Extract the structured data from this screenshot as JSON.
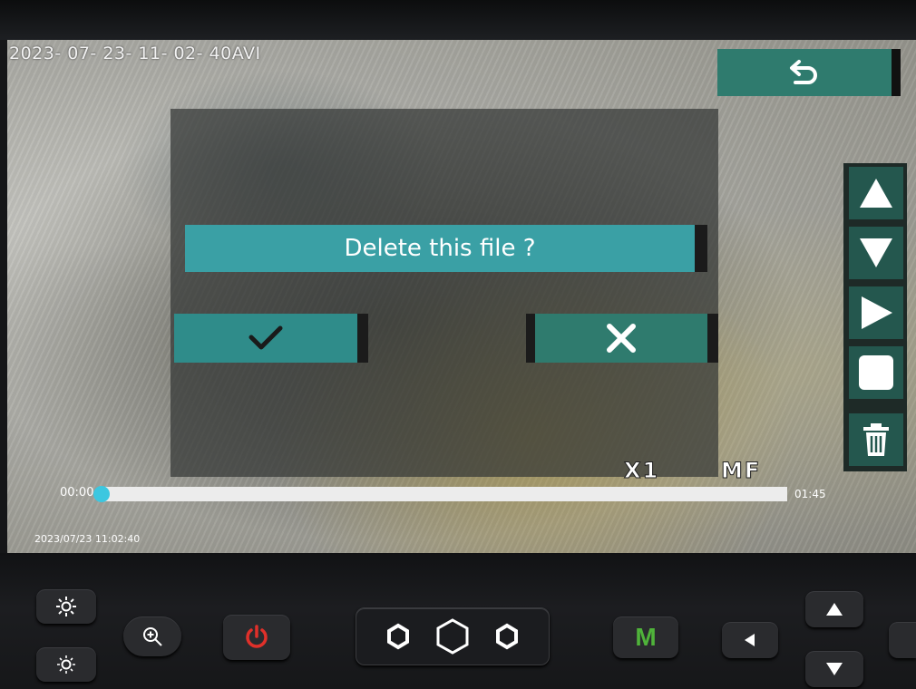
{
  "screen": {
    "filename": "2023- 07- 23- 11- 02- 40AVI",
    "dialog": {
      "message": "Delete this file ?",
      "confirm_icon": "check-icon",
      "cancel_icon": "x-icon"
    },
    "back_icon": "back-arrow-icon",
    "side_buttons": [
      {
        "name": "up-button",
        "icon": "triangle-up-icon"
      },
      {
        "name": "down-button",
        "icon": "triangle-down-icon"
      },
      {
        "name": "play-button",
        "icon": "play-icon"
      },
      {
        "name": "stop-button",
        "icon": "stop-icon"
      },
      {
        "name": "delete-button",
        "icon": "trash-icon"
      }
    ],
    "zoom_label": "X1",
    "focus_label": "MF",
    "playback": {
      "current_time": "00:00",
      "total_time": "01:45",
      "progress": 0
    },
    "datestamp": "2023/07/23 11:02:40"
  },
  "hardware_buttons": {
    "mode_label": "M",
    "icons": [
      "brightness-up-icon",
      "brightness-down-icon",
      "zoom-in-icon",
      "power-icon",
      "hexagon-icons",
      "mode-button",
      "left-arrow-icon",
      "up-arrow-icon",
      "down-arrow-icon"
    ]
  },
  "colors": {
    "dialog_accent": "#3aa0a5",
    "button_teal": "#2f7b6e",
    "progress_knob": "#3cc7e0",
    "power_red": "#e0302a",
    "mode_green": "#4fb33a"
  }
}
